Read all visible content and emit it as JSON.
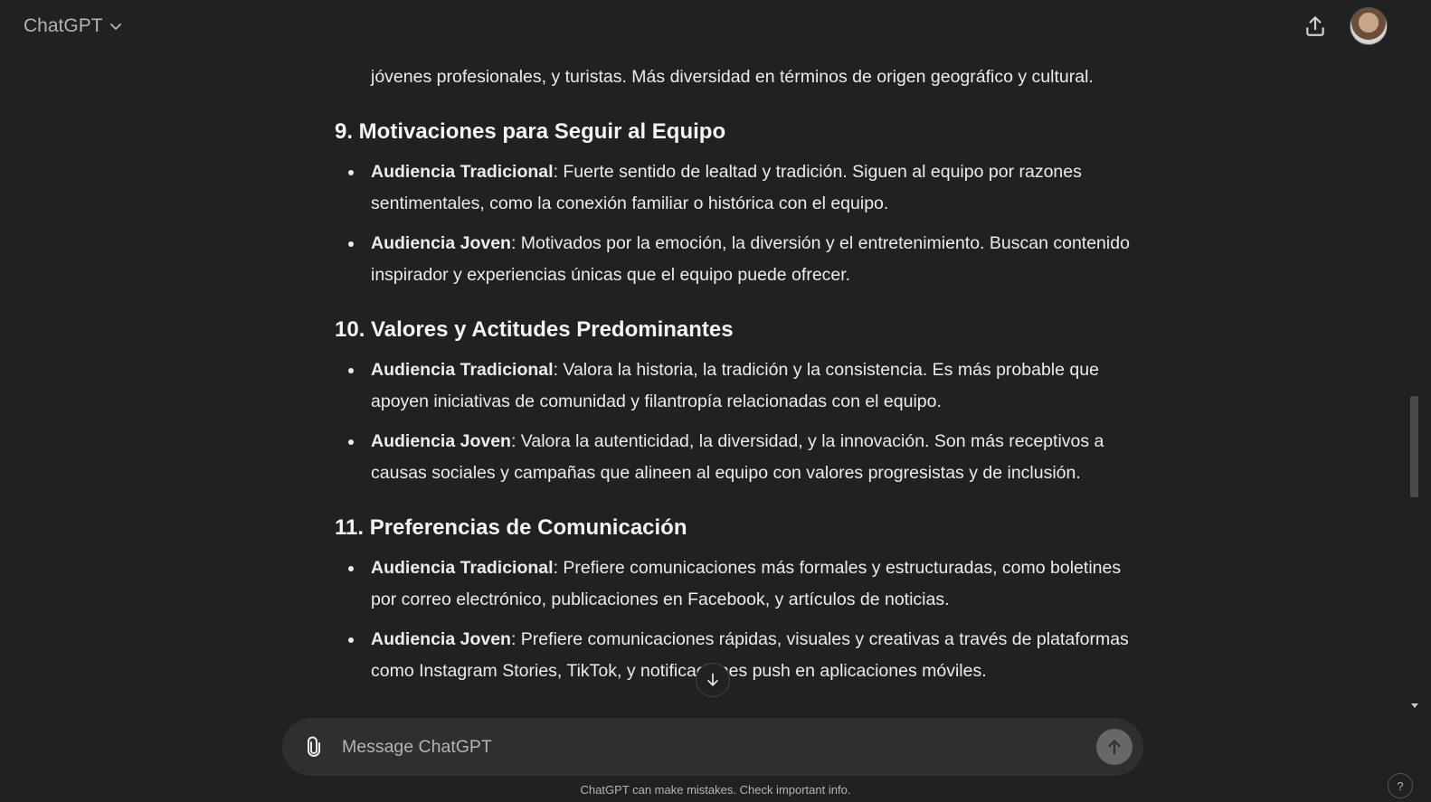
{
  "header": {
    "model_label": "ChatGPT",
    "share_icon": "share-icon",
    "avatar_icon": "user-avatar"
  },
  "conversation": {
    "continuation_text": "jóvenes profesionales, y turistas. Más diversidad en términos de origen geográfico y cultural.",
    "sections": [
      {
        "heading": "9. Motivaciones para Seguir al Equipo",
        "items": [
          {
            "label": "Audiencia Tradicional",
            "text": ": Fuerte sentido de lealtad y tradición. Siguen al equipo por razones sentimentales, como la conexión familiar o histórica con el equipo."
          },
          {
            "label": "Audiencia Joven",
            "text": ": Motivados por la emoción, la diversión y el entretenimiento. Buscan contenido inspirador y experiencias únicas que el equipo puede ofrecer."
          }
        ]
      },
      {
        "heading": "10. Valores y Actitudes Predominantes",
        "items": [
          {
            "label": "Audiencia Tradicional",
            "text": ": Valora la historia, la tradición y la consistencia. Es más probable que apoyen iniciativas de comunidad y filantropía relacionadas con el equipo."
          },
          {
            "label": "Audiencia Joven",
            "text": ": Valora la autenticidad, la diversidad, y la innovación. Son más receptivos a causas sociales y campañas que alineen al equipo con valores progresistas y de inclusión."
          }
        ]
      },
      {
        "heading": "11. Preferencias de Comunicación",
        "items": [
          {
            "label": "Audiencia Tradicional",
            "text": ": Prefiere comunicaciones más formales y estructuradas, como boletines por correo electrónico, publicaciones en Facebook, y artículos de noticias."
          },
          {
            "label": "Audiencia Joven",
            "text": ": Prefiere comunicaciones rápidas, visuales y creativas a través de plataformas como Instagram Stories, TikTok, y notificaciones push en aplicaciones móviles."
          }
        ]
      }
    ]
  },
  "composer": {
    "placeholder": "Message ChatGPT",
    "value": ""
  },
  "footer": {
    "disclaimer": "ChatGPT can make mistakes. Check important info.",
    "help_label": "?"
  }
}
